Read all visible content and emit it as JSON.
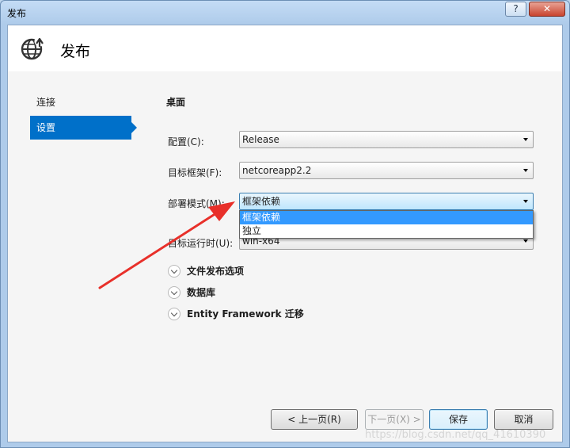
{
  "window": {
    "title": "发布",
    "help_label": "?",
    "close_label": "✕"
  },
  "header": {
    "title": "发布",
    "icon": "globe-publish-icon"
  },
  "nav": {
    "items": [
      {
        "label": "连接",
        "active": false
      },
      {
        "label": "设置",
        "active": true
      }
    ]
  },
  "settings": {
    "section_title": "桌面",
    "configuration": {
      "label": "配置(C):",
      "value": "Release"
    },
    "target_framework": {
      "label": "目标框架(F):",
      "value": "netcoreapp2.2"
    },
    "deployment_mode": {
      "label": "部署模式(M):",
      "value": "框架依赖",
      "options": [
        "框架依赖",
        "独立"
      ],
      "selected_index": 0
    },
    "target_runtime": {
      "label": "目标运行时(U):",
      "value": "win-x64"
    }
  },
  "expanders": [
    {
      "label": "文件发布选项"
    },
    {
      "label": "数据库"
    },
    {
      "label": "Entity Framework 迁移"
    }
  ],
  "buttons": {
    "prev": "< 上一页(R)",
    "next": "下一页(X) >",
    "save": "保存",
    "cancel": "取消"
  },
  "watermark": "https://blog.csdn.net/qq_41610390",
  "colors": {
    "accent": "#0070c9",
    "annotation_arrow": "#e8302a",
    "dropdown_highlight": "#3399ff"
  }
}
